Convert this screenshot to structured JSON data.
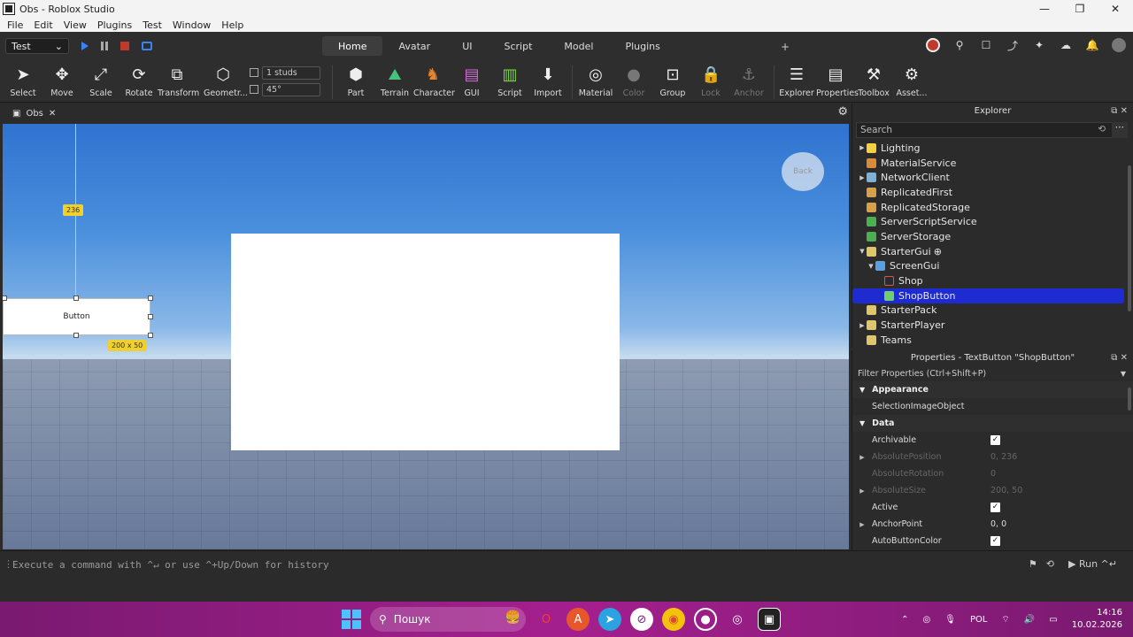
{
  "window": {
    "title": "Obs - Roblox Studio",
    "minimize": "—",
    "maximize": "❐",
    "close": "✕"
  },
  "menu": [
    "File",
    "Edit",
    "View",
    "Plugins",
    "Test",
    "Window",
    "Help"
  ],
  "ribbon": {
    "mode": "Test",
    "tabs": [
      "Home",
      "Avatar",
      "UI",
      "Script",
      "Model",
      "Plugins"
    ],
    "active_tab": "Home",
    "add_tab": "+"
  },
  "toolbar": {
    "tools": [
      {
        "label": "Select",
        "icon": "cursor-icon"
      },
      {
        "label": "Move",
        "icon": "move-icon"
      },
      {
        "label": "Scale",
        "icon": "scale-icon"
      },
      {
        "label": "Rotate",
        "icon": "rotate-icon"
      },
      {
        "label": "Transform",
        "icon": "transform-icon"
      },
      {
        "label": "Geometr...",
        "icon": "geometry-icon"
      },
      {
        "label": "Part",
        "icon": "part-icon"
      },
      {
        "label": "Terrain",
        "icon": "terrain-icon"
      },
      {
        "label": "Character",
        "icon": "character-icon"
      },
      {
        "label": "GUI",
        "icon": "gui-icon"
      },
      {
        "label": "Script",
        "icon": "script-icon"
      },
      {
        "label": "Import",
        "icon": "import-icon"
      },
      {
        "label": "Material",
        "icon": "material-icon"
      },
      {
        "label": "Color",
        "icon": "color-icon"
      },
      {
        "label": "Group",
        "icon": "group-icon"
      },
      {
        "label": "Lock",
        "icon": "lock-icon"
      },
      {
        "label": "Anchor",
        "icon": "anchor-icon"
      },
      {
        "label": "Explorer",
        "icon": "explorer-icon"
      },
      {
        "label": "Properties",
        "icon": "properties-icon"
      },
      {
        "label": "Toolbox",
        "icon": "toolbox-icon"
      },
      {
        "label": "Asset...",
        "icon": "asset-icon"
      }
    ],
    "move_step": "1 studs",
    "rotate_step": "45°"
  },
  "document": {
    "tab": "Obs",
    "close": "✕"
  },
  "viewport": {
    "height_tag": "236",
    "button_text": "Button",
    "size_tag": "200 x 50",
    "back_text": "Back"
  },
  "explorer": {
    "title": "Explorer",
    "search_placeholder": "Search",
    "items": [
      {
        "name": "Lighting",
        "arrow": "▶",
        "color": "#f5d142"
      },
      {
        "name": "MaterialService",
        "arrow": "",
        "color": "#d98a3a"
      },
      {
        "name": "NetworkClient",
        "arrow": "▶",
        "color": "#7fb0d8"
      },
      {
        "name": "ReplicatedFirst",
        "arrow": "",
        "color": "#d9a04a"
      },
      {
        "name": "ReplicatedStorage",
        "arrow": "",
        "color": "#d9a04a"
      },
      {
        "name": "ServerScriptService",
        "arrow": "",
        "color": "#4caf50"
      },
      {
        "name": "ServerStorage",
        "arrow": "",
        "color": "#4caf50"
      },
      {
        "name": "StarterGui",
        "arrow": "▼",
        "color": "#e0c66a"
      },
      {
        "name": "ScreenGui",
        "arrow": "▼",
        "color": "#5aa0e0"
      },
      {
        "name": "Shop",
        "arrow": "",
        "color": "#d9534f"
      },
      {
        "name": "ShopButton",
        "arrow": "",
        "color": "#6fcf6f"
      },
      {
        "name": "StarterPack",
        "arrow": "",
        "color": "#e0c66a"
      },
      {
        "name": "StarterPlayer",
        "arrow": "▶",
        "color": "#e0c66a"
      },
      {
        "name": "Teams",
        "arrow": "",
        "color": "#e0c66a"
      }
    ],
    "selected": "ShopButton"
  },
  "properties": {
    "title": "Properties - TextButton \"ShopButton\"",
    "filter": "Filter Properties (Ctrl+Shift+P)",
    "sections": [
      {
        "title": "Appearance",
        "rows": [
          {
            "name": "SelectionImageObject",
            "value": "",
            "expand": "",
            "dim": false,
            "check": false
          }
        ]
      },
      {
        "title": "Data",
        "rows": [
          {
            "name": "Archivable",
            "value": "",
            "expand": "",
            "dim": false,
            "check": true
          },
          {
            "name": "AbsolutePosition",
            "value": "0, 236",
            "expand": "▶",
            "dim": true,
            "check": false
          },
          {
            "name": "AbsoluteRotation",
            "value": "0",
            "expand": "",
            "dim": true,
            "check": false
          },
          {
            "name": "AbsoluteSize",
            "value": "200, 50",
            "expand": "▶",
            "dim": true,
            "check": false
          },
          {
            "name": "Active",
            "value": "",
            "expand": "",
            "dim": false,
            "check": true
          },
          {
            "name": "AnchorPoint",
            "value": "0, 0",
            "expand": "▶",
            "dim": false,
            "check": false
          },
          {
            "name": "AutoButtonColor",
            "value": "",
            "expand": "",
            "dim": false,
            "check": true
          }
        ]
      }
    ]
  },
  "command_bar": {
    "placeholder": "Execute a command with ^↵ or use ^+Up/Down for history",
    "run": "▶ Run ^↵"
  },
  "taskbar": {
    "search": "Пошук",
    "language": "POL",
    "time": "14:16",
    "date": "10.02.2026"
  }
}
